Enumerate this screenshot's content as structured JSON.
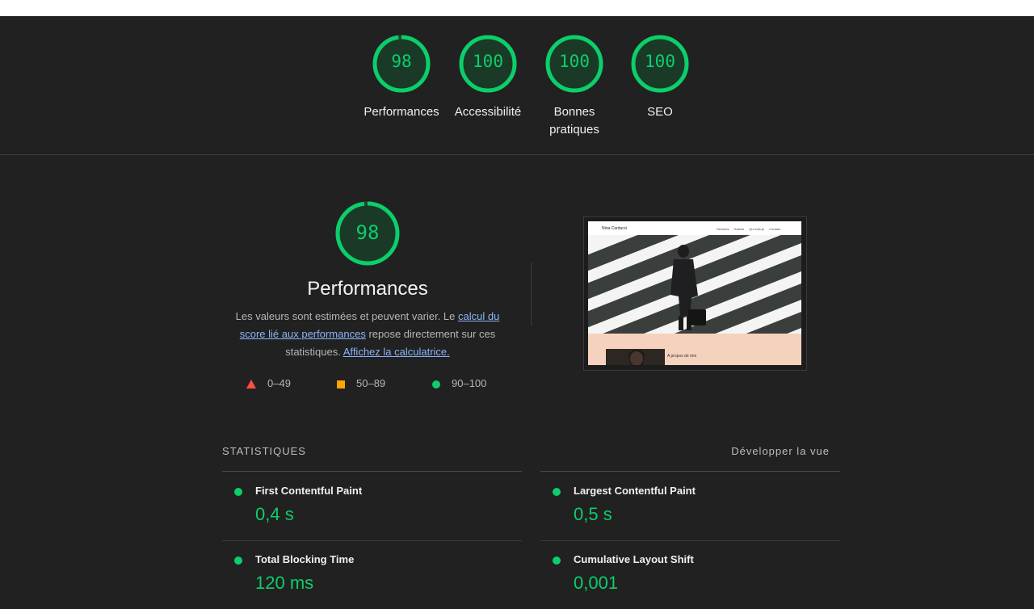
{
  "header_gauges": [
    {
      "score": "98",
      "label": "Performances",
      "value_percent": 98
    },
    {
      "score": "100",
      "label": "Accessibilité",
      "value_percent": 100
    },
    {
      "score": "100",
      "label": "Bonnes pratiques",
      "value_percent": 100
    },
    {
      "score": "100",
      "label": "SEO",
      "value_percent": 100
    }
  ],
  "performance": {
    "score": "98",
    "value_percent": 98,
    "title": "Performances",
    "desc_before": "Les valeurs sont estimées et peuvent varier. Le ",
    "link_calc": "calcul du score lié aux performances",
    "desc_middle": " repose directement sur ces statistiques. ",
    "link_calculator": "Affichez la calculatrice."
  },
  "legend": [
    {
      "shape": "triangle",
      "label": "0–49",
      "color": "#ff4e42"
    },
    {
      "shape": "square",
      "label": "50–89",
      "color": "#ffa400"
    },
    {
      "shape": "circle",
      "label": "90–100",
      "color": "#0cce6b"
    }
  ],
  "screenshot": {
    "site_name": "Nina Carducci",
    "nav": [
      "Services",
      "Galerie",
      "Qui suis-je",
      "Contact"
    ],
    "section_title": "A propos de moi"
  },
  "stats": {
    "title": "STATISTIQUES",
    "expand_label": "Développer la vue",
    "metrics": [
      {
        "name": "First Contentful Paint",
        "value": "0,4 s"
      },
      {
        "name": "Largest Contentful Paint",
        "value": "0,5 s"
      },
      {
        "name": "Total Blocking Time",
        "value": "120 ms"
      },
      {
        "name": "Cumulative Layout Shift",
        "value": "0,001"
      }
    ]
  },
  "colors": {
    "pass": "#0cce6b",
    "average": "#ffa400",
    "fail": "#ff4e42",
    "background": "#212121"
  }
}
